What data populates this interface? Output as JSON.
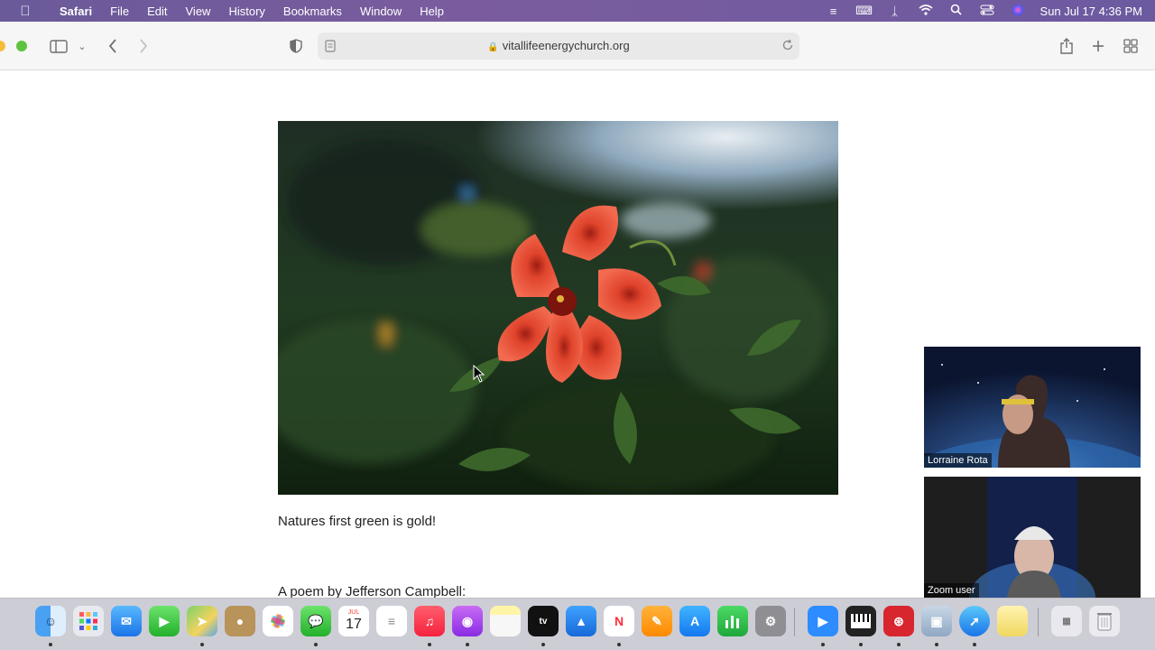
{
  "menubar": {
    "app_name": "Safari",
    "items": [
      "File",
      "Edit",
      "View",
      "History",
      "Bookmarks",
      "Window",
      "Help"
    ],
    "clock": "Sun Jul 17  4:36 PM",
    "status_icons": [
      "stage-manager-icon",
      "keyboard-icon",
      "bluetooth-icon",
      "wifi-icon",
      "search-icon",
      "control-center-icon",
      "siri-icon"
    ]
  },
  "browser": {
    "url": "vitallifeenergychurch.org"
  },
  "page": {
    "caption": "Natures first green is gold!",
    "poem_line": "A poem by Jefferson Campbell:"
  },
  "participants": [
    {
      "name": "Lorraine Rota"
    },
    {
      "name": "Zoom user"
    }
  ],
  "calendar": {
    "month": "JUL",
    "day": "17"
  },
  "dock_icons": [
    "finder-icon",
    "launchpad-icon",
    "mail-icon",
    "facetime-icon",
    "maps-icon",
    "contacts-icon",
    "photos-icon",
    "messages-icon",
    "calendar-icon",
    "reminders-icon",
    "music-icon",
    "podcasts-icon",
    "notes-icon",
    "appletv-icon",
    "keynote-icon",
    "news-icon",
    "pages-icon",
    "appstore-icon",
    "numbers-icon",
    "settings-icon",
    "zoom-icon",
    "piano-icon",
    "app-icon",
    "preview-icon",
    "safari-icon",
    "folder-icon",
    "document-icon",
    "trash-icon"
  ]
}
